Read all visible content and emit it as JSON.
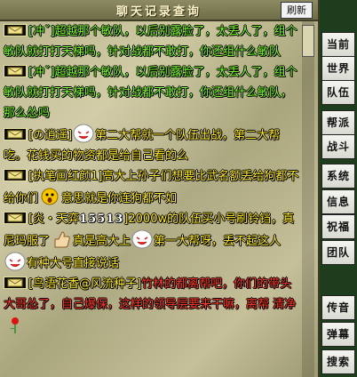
{
  "window": {
    "title": "聊天记录查询",
    "refresh_label": "刷新"
  },
  "tabs": [
    "当前",
    "世界",
    "队伍",
    "帮派",
    "战斗",
    "系统",
    "信息",
    "祝福",
    "团队",
    "传音",
    "弹幕",
    "搜索"
  ],
  "messages": [
    {
      "name": "[冲ˇ]",
      "text": "超越那个敏队，以后别露脸了，太丢人了，组个敏队就打打天梯吗，针对战都不敢打，你还组什么敏队"
    },
    {
      "name": "[冲ˇ]",
      "text": "超越那个敏队，以后别露脸了，太丢人了，组个敏队就打打天梯吗，针对战都不敢打，你还组什么敏队，那么怂吗"
    },
    {
      "name": "[の逍遥]",
      "text": "第二大帮就一个队伍出战，第二大帮吃。花钱买的物资都是给自己看的么"
    },
    {
      "name": "[执笔画红颜1]",
      "text_a": "高大上孙子们想要比武名额丢给狗都不给你们",
      "text_b": "意思就是你连狗都不如"
    },
    {
      "name": "[炎・天弈",
      "digits": "15513",
      "name_end": "]",
      "text_a": "2000w的队伍买小号刷铃铛，真尼玛服了",
      "text_b": "真是高大上",
      "text_c": "第一大帮呀，丢不起这人",
      "text_d": "有种大号直接说话"
    },
    {
      "name": "[鸟语花香@风流种子]",
      "text": "竹林的都离帮吧，你们的带头大哥怂了，自己爆保，这样的领导层要来干嘛，离帮 清净"
    }
  ],
  "icons": {
    "channel": "mail-icon",
    "emoticons": [
      "laughing-face-icon",
      "laughing-face-icon",
      "surprised-face-icon",
      "thumbs-up-icon",
      "laughing-face-icon",
      "laughing-face-icon",
      "rose-icon"
    ]
  },
  "colors": {
    "world_name": "#7dff2f",
    "team_name": "#ffea2e",
    "announce": "#ff3a2a"
  }
}
